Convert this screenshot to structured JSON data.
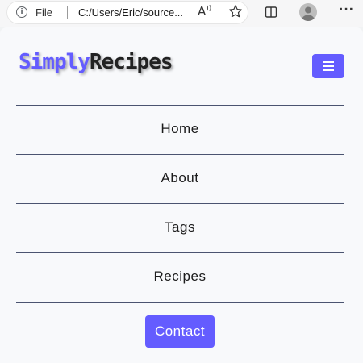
{
  "browser": {
    "file_label": "File",
    "url": "C:/Users/Eric/source...",
    "read_aloud_glyph": "Aᴬ"
  },
  "header": {
    "logo_first": "Simply",
    "logo_second": "Recipes",
    "menu_icon": "hamburger-icon"
  },
  "nav": {
    "items": [
      {
        "label": "Home"
      },
      {
        "label": "About"
      },
      {
        "label": "Tags"
      },
      {
        "label": "Recipes"
      }
    ],
    "contact_label": "Contact"
  },
  "colors": {
    "accent": "#645cff",
    "divider": "#4b5470",
    "page_bg": "#f8f9fb"
  }
}
